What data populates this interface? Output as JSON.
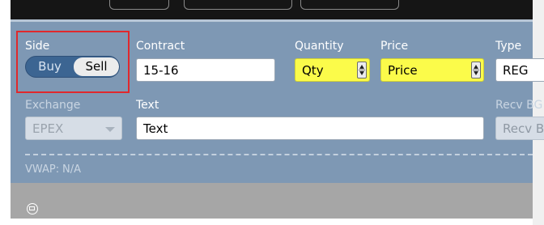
{
  "side": {
    "label": "Side",
    "buy": "Buy",
    "sell": "Sell",
    "selected": "Sell"
  },
  "contract": {
    "label": "Contract",
    "value": "15-16"
  },
  "quantity": {
    "label": "Quantity",
    "placeholder": "Qty"
  },
  "price": {
    "label": "Price",
    "placeholder": "Price"
  },
  "type": {
    "label": "Type",
    "value": "REG"
  },
  "exchange": {
    "label": "Exchange",
    "value": "EPEX"
  },
  "text": {
    "label": "Text",
    "value": "Text"
  },
  "recv": {
    "label": "Recv BG",
    "value": "Recv BG"
  },
  "vwap": {
    "label": "VWAP:",
    "value": "N/A"
  },
  "colors": {
    "panel": "#7e98b4",
    "highlight_yellow": "#fbfb4a",
    "selection_outline": "#e0282c",
    "toggle_active": "#3c6592"
  },
  "icons": {
    "status": "message-icon",
    "spinner": "spinner-arrows-icon",
    "dropdown": "chevron-down-icon"
  }
}
